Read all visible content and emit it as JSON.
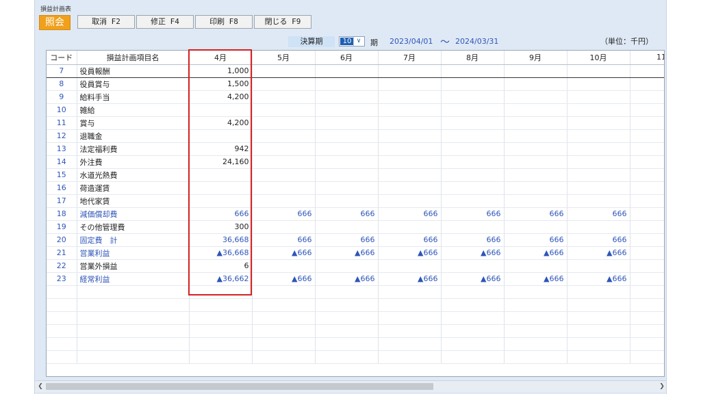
{
  "window": {
    "title": "損益計画表"
  },
  "toolbar": {
    "mode": "照会",
    "cancel": "取消 F2",
    "edit": "修正 F4",
    "print": "印刷 F8",
    "close": "閉じる F9"
  },
  "period": {
    "label": "決算期",
    "value": "10",
    "term_label": "期",
    "start_date": "2023/04/01",
    "separator": "～",
    "end_date": "2024/03/31",
    "unit": "（単位：千円）"
  },
  "table": {
    "code_header": "コード",
    "name_header": "損益計画項目名",
    "months": [
      "4月",
      "5月",
      "6月",
      "7月",
      "8月",
      "9月",
      "10月",
      "11"
    ],
    "rows": [
      {
        "code": "7",
        "name": "役員報酬",
        "values": [
          "1,000",
          "",
          "",
          "",
          "",
          "",
          "",
          ""
        ]
      },
      {
        "code": "8",
        "name": "役員賞与",
        "values": [
          "1,500",
          "",
          "",
          "",
          "",
          "",
          "",
          ""
        ]
      },
      {
        "code": "9",
        "name": "給料手当",
        "values": [
          "4,200",
          "",
          "",
          "",
          "",
          "",
          "",
          ""
        ]
      },
      {
        "code": "10",
        "name": "雑給",
        "values": [
          "",
          "",
          "",
          "",
          "",
          "",
          "",
          ""
        ]
      },
      {
        "code": "11",
        "name": "賞与",
        "values": [
          "4,200",
          "",
          "",
          "",
          "",
          "",
          "",
          ""
        ]
      },
      {
        "code": "12",
        "name": "退職金",
        "values": [
          "",
          "",
          "",
          "",
          "",
          "",
          "",
          ""
        ]
      },
      {
        "code": "13",
        "name": "法定福利費",
        "values": [
          "942",
          "",
          "",
          "",
          "",
          "",
          "",
          ""
        ]
      },
      {
        "code": "14",
        "name": "外注費",
        "values": [
          "24,160",
          "",
          "",
          "",
          "",
          "",
          "",
          ""
        ]
      },
      {
        "code": "15",
        "name": "水道光熱費",
        "values": [
          "",
          "",
          "",
          "",
          "",
          "",
          "",
          ""
        ]
      },
      {
        "code": "16",
        "name": "荷造運賃",
        "values": [
          "",
          "",
          "",
          "",
          "",
          "",
          "",
          ""
        ]
      },
      {
        "code": "17",
        "name": "地代家賃",
        "values": [
          "",
          "",
          "",
          "",
          "",
          "",
          "",
          ""
        ]
      },
      {
        "code": "18",
        "name": "減価償却費",
        "values": [
          "666",
          "666",
          "666",
          "666",
          "666",
          "666",
          "666",
          ""
        ]
      },
      {
        "code": "19",
        "name": "その他管理費",
        "values": [
          "300",
          "",
          "",
          "",
          "",
          "",
          "",
          ""
        ]
      },
      {
        "code": "20",
        "name": "固定費　計",
        "values": [
          "36,668",
          "666",
          "666",
          "666",
          "666",
          "666",
          "666",
          ""
        ]
      },
      {
        "code": "21",
        "name": "営業利益",
        "values": [
          "▲36,668",
          "▲666",
          "▲666",
          "▲666",
          "▲666",
          "▲666",
          "▲666",
          ""
        ]
      },
      {
        "code": "22",
        "name": "営業外損益",
        "values": [
          "6",
          "",
          "",
          "",
          "",
          "",
          "",
          ""
        ]
      },
      {
        "code": "23",
        "name": "経常利益",
        "values": [
          "▲36,662",
          "▲666",
          "▲666",
          "▲666",
          "▲666",
          "▲666",
          "▲666",
          ""
        ]
      }
    ],
    "blue_rows": [
      "18",
      "20",
      "21",
      "23"
    ],
    "empty_rows": 6
  },
  "scroll": {
    "left_icon": "chevron-left-icon",
    "right_icon": "chevron-right-icon"
  }
}
